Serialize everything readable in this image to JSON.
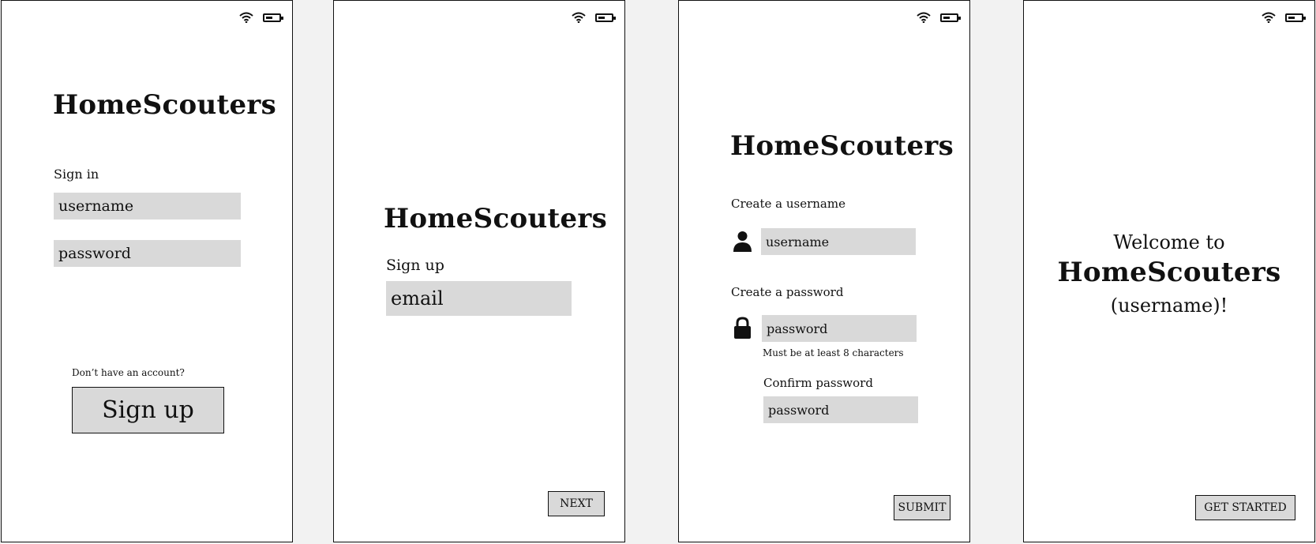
{
  "brand": "HomeScouters",
  "signin": {
    "heading": "Sign in",
    "username_placeholder": "username",
    "password_placeholder": "password",
    "no_account": "Don’t have an account?",
    "signup_button": "Sign up"
  },
  "signup": {
    "heading": "Sign up",
    "email_placeholder": "email",
    "next_button": "NEXT"
  },
  "create": {
    "username_heading": "Create a username",
    "username_placeholder": "username",
    "password_heading": "Create a password",
    "password_placeholder": "password",
    "password_hint": "Must be at least 8 characters",
    "confirm_heading": "Confirm password",
    "confirm_placeholder": "password",
    "submit_button": "SUBMIT"
  },
  "welcome": {
    "line1": "Welcome to",
    "line3": "(username)!",
    "get_started_button": "GET STARTED"
  },
  "icons": {
    "status": [
      "wifi-icon",
      "battery-icon"
    ],
    "form": [
      "user-icon",
      "lock-icon"
    ]
  }
}
